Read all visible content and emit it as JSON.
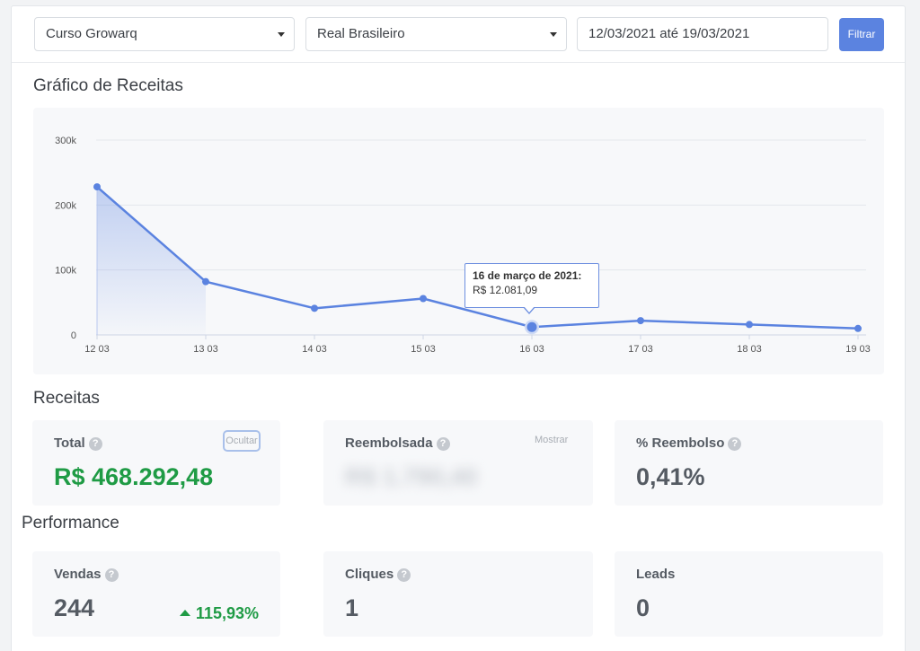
{
  "filters": {
    "course": "Curso Growarq",
    "currency": "Real Brasileiro",
    "date_range": "12/03/2021 até 19/03/2021",
    "filter_label": "Filtrar"
  },
  "chart_section": {
    "title": "Gráfico de Receitas"
  },
  "chart_data": {
    "type": "area",
    "categories": [
      "12 03",
      "13 03",
      "14 03",
      "15 03",
      "16 03",
      "17 03",
      "18 03",
      "19 03"
    ],
    "values": [
      228000,
      82000,
      41000,
      56000,
      12081.09,
      22000,
      16000,
      10000
    ],
    "y_ticks": [
      "0",
      "100k",
      "200k",
      "300k"
    ],
    "ylim": [
      0,
      300000
    ],
    "grid": true,
    "color": "#5b83e0",
    "highlight_index": 4,
    "tooltip": {
      "title": "16 de março de 2021:",
      "value": "R$ 12.081,09"
    }
  },
  "receitas": {
    "title": "Receitas",
    "total": {
      "label": "Total",
      "value": "R$ 468.292,48",
      "toggle": "Ocultar"
    },
    "reembolsada": {
      "label": "Reembolsada",
      "value": "R$ 1.790,40",
      "toggle": "Mostrar"
    },
    "pct_reembolso": {
      "label": "% Reembolso",
      "value": "0,41%"
    }
  },
  "performance": {
    "title": "Performance",
    "vendas": {
      "label": "Vendas",
      "value": "244",
      "trend": "115,93%"
    },
    "cliques": {
      "label": "Cliques",
      "value": "1"
    },
    "leads": {
      "label": "Leads",
      "value": "0"
    }
  }
}
